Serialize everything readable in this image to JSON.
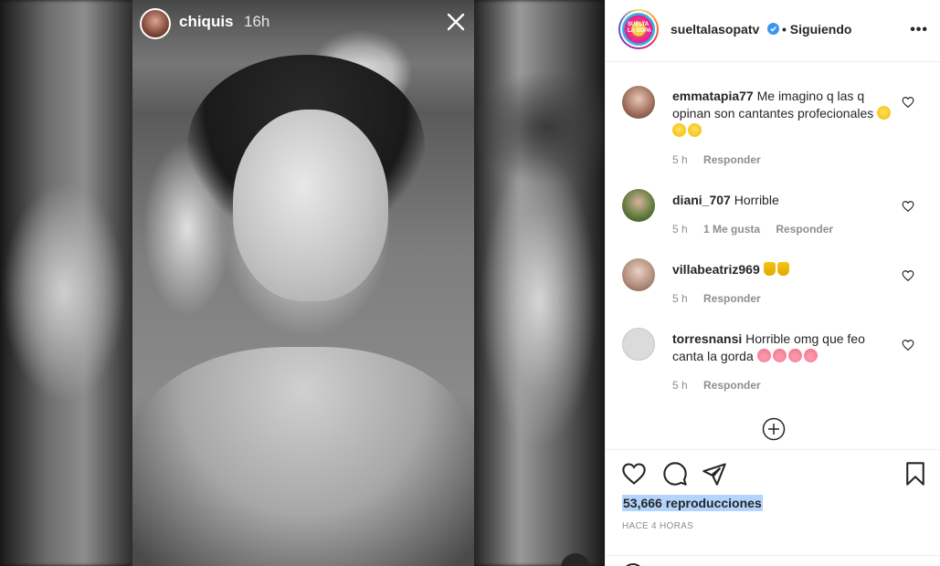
{
  "story": {
    "username": "chiquis",
    "time": "16h"
  },
  "post": {
    "account": "sueltalasopatv",
    "following_label": "• Siguiendo",
    "more_label": "•••",
    "avatar_logo_text": "SUELTA LA SOPA"
  },
  "comments": [
    {
      "user": "emmatapia77",
      "text": "Me imagino q las q opinan son cantantes profecionales",
      "emoji": "laugh",
      "emoji_count": 3,
      "time": "5 h",
      "likes": "",
      "reply": "Responder"
    },
    {
      "user": "diani_707",
      "text": "Horrible",
      "emoji": "",
      "emoji_count": 0,
      "time": "5 h",
      "likes": "1 Me gusta",
      "reply": "Responder"
    },
    {
      "user": "villabeatriz969",
      "text": "",
      "emoji": "thumbdown",
      "emoji_count": 2,
      "time": "5 h",
      "likes": "",
      "reply": "Responder"
    },
    {
      "user": "torresnansi",
      "text": "Horrible omg que feo canta la gorda",
      "emoji": "pig",
      "emoji_count": 4,
      "time": "5 h",
      "likes": "",
      "reply": "Responder"
    }
  ],
  "stats": {
    "views": "53,666 reproducciones",
    "posted": "HACE 4 HORAS"
  },
  "icons": {
    "close": "close-icon",
    "like": "heart-icon",
    "comment": "comment-icon",
    "share": "share-icon",
    "save": "bookmark-icon",
    "add": "plus-circle-icon",
    "verified": "verified-badge-icon"
  },
  "colors": {
    "text": "#262626",
    "muted": "#8e8e8e",
    "verified": "#3897f0",
    "selection": "#b3d4fc"
  }
}
